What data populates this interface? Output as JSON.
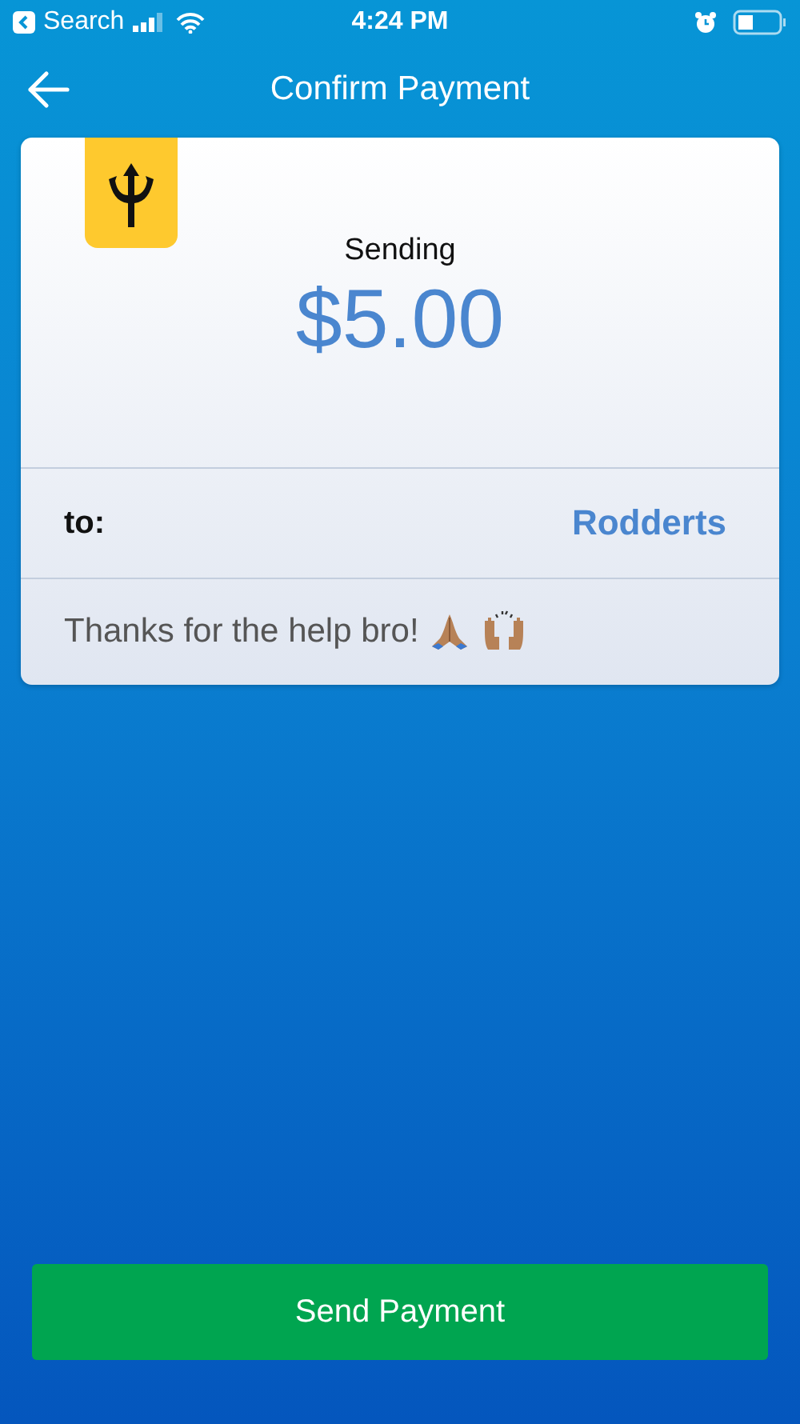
{
  "status_bar": {
    "back_app": "Search",
    "time": "4:24 PM"
  },
  "header": {
    "title": "Confirm Payment"
  },
  "card": {
    "label": "Sending",
    "amount": "$5.00",
    "recipient_label": "to:",
    "recipient": "Rodderts",
    "note": "Thanks for the help bro!"
  },
  "action": {
    "label": "Send Payment"
  }
}
